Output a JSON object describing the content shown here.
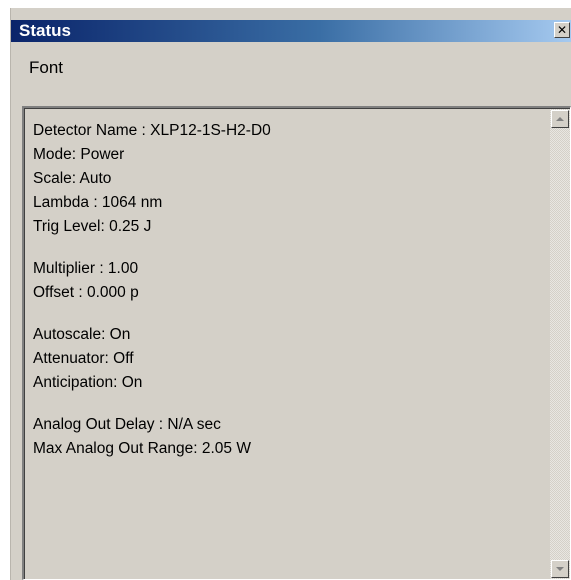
{
  "window": {
    "title": "Status",
    "close_glyph": "✕"
  },
  "menu": {
    "items": [
      "Font"
    ]
  },
  "status_lines": [
    "Detector Name : XLP12-1S-H2-D0",
    "Mode: Power",
    "Scale: Auto",
    "Lambda : 1064 nm",
    "Trig Level: 0.25 J",
    "Multiplier : 1.00",
    "Offset : 0.000 p",
    "Autoscale: On",
    "Attenuator: Off",
    "Anticipation: On",
    "Analog Out Delay : N/A sec",
    "Max Analog Out Range: 2.05 W"
  ],
  "colors": {
    "titlebar_start": "#0a246a",
    "titlebar_end": "#a6caf0",
    "window_bg": "#d4d0c8"
  },
  "icons": {
    "close": "close-icon",
    "scroll_up": "scroll-up-arrow-icon",
    "scroll_down": "scroll-down-arrow-icon"
  }
}
